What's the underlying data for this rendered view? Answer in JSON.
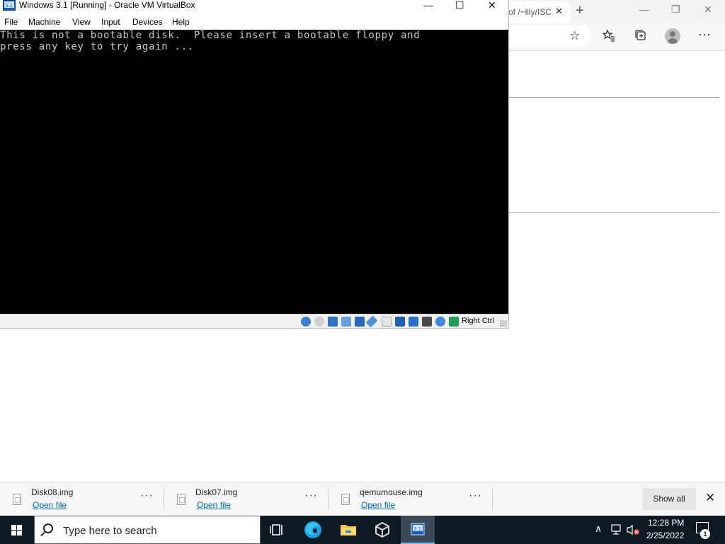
{
  "vbox": {
    "title": "Windows 3.1 [Running] - Oracle VM VirtualBox",
    "menu": [
      "File",
      "Machine",
      "View",
      "Input",
      "Devices",
      "Help"
    ],
    "console_lines": [
      "This is not a bootable disk.  Please insert a bootable floppy and",
      "press any key to try again ..."
    ],
    "host_key": "Right Ctrl",
    "status_icons": [
      "hard-disk-icon",
      "optical-drive-icon",
      "floppy-icon",
      "audio-icon",
      "network-icon",
      "usb-icon",
      "shared-folders-icon",
      "display-icon",
      "video-capture-icon",
      "virtualization-icon",
      "mouse-integration-icon",
      "keyboard-icon"
    ]
  },
  "browser": {
    "tab_title": "of /~lily/ISO",
    "tab_close": "✕",
    "new_tab": "+",
    "minimize": "—",
    "maximize": "❐",
    "close": "✕",
    "toolbar_icons": [
      "favorite-star-icon",
      "favorites-icon",
      "collections-icon",
      "profile-icon",
      "more-icon"
    ]
  },
  "downloads": {
    "items": [
      {
        "name": "Disk08.img",
        "action": "Open file",
        "more": "···"
      },
      {
        "name": "Disk07.img",
        "action": "Open file",
        "more": "···"
      },
      {
        "name": "qemumouse.img",
        "action": "Open file",
        "more": "···"
      }
    ],
    "show_all": "Show all",
    "close": "✕"
  },
  "taskbar": {
    "search_placeholder": "Type here to search",
    "apps": [
      "task-view-icon",
      "edge-icon",
      "file-explorer-icon",
      "virtualbox-icon",
      "windows31-vm-icon"
    ],
    "time": "12:28 PM",
    "date": "2/25/2022",
    "notification_count": "1"
  },
  "colors": {
    "taskbar": "#0f1923",
    "console_bg": "#000000",
    "console_text": "#c8c8c8",
    "link": "#0066b4"
  }
}
